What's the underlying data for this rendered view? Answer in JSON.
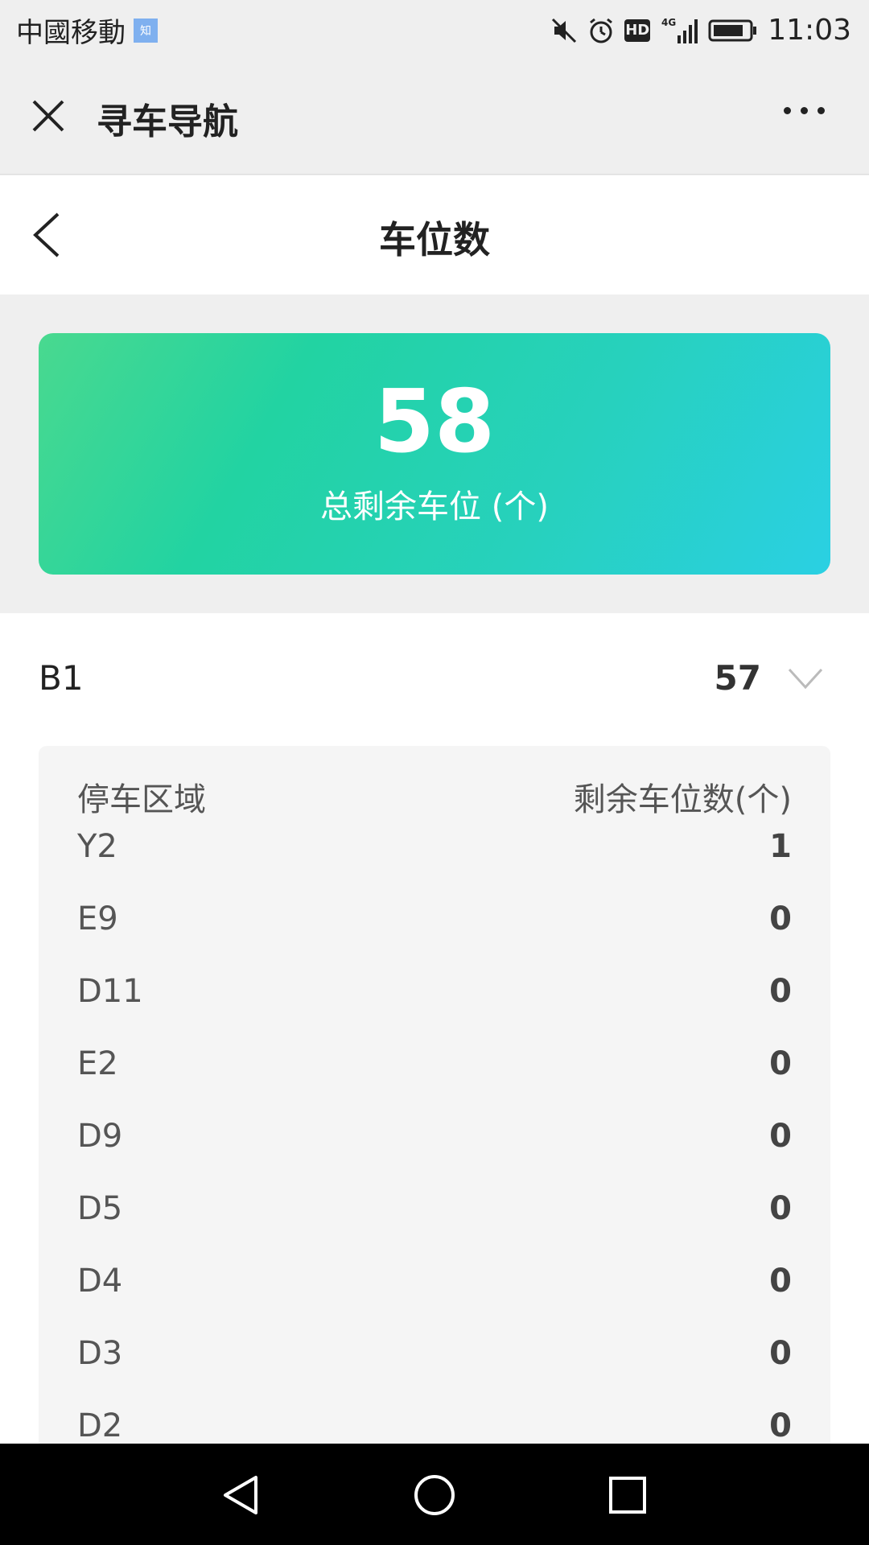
{
  "status_bar": {
    "carrier": "中國移動",
    "app_badge": "知",
    "hd": "HD",
    "network": "4G",
    "time": "11:03"
  },
  "mp_bar": {
    "title": "寻车导航"
  },
  "page_header": {
    "title": "车位数"
  },
  "summary": {
    "total_value": "58",
    "label": "总剩余车位 (个)"
  },
  "floor": {
    "name": "B1",
    "count": "57",
    "expanded": true
  },
  "zones": {
    "header": {
      "area": "停车区域",
      "remaining": "剩余车位数(个)"
    },
    "rows": [
      {
        "name": "Y2",
        "count": "1"
      },
      {
        "name": "E9",
        "count": "0"
      },
      {
        "name": "D11",
        "count": "0"
      },
      {
        "name": "E2",
        "count": "0"
      },
      {
        "name": "D9",
        "count": "0"
      },
      {
        "name": "D5",
        "count": "0"
      },
      {
        "name": "D4",
        "count": "0"
      },
      {
        "name": "D3",
        "count": "0"
      },
      {
        "name": "D2",
        "count": "0"
      }
    ]
  },
  "colors": {
    "card_gradient_start": "#49d98f",
    "card_gradient_end": "#2ad0e3",
    "background": "#efefef"
  }
}
